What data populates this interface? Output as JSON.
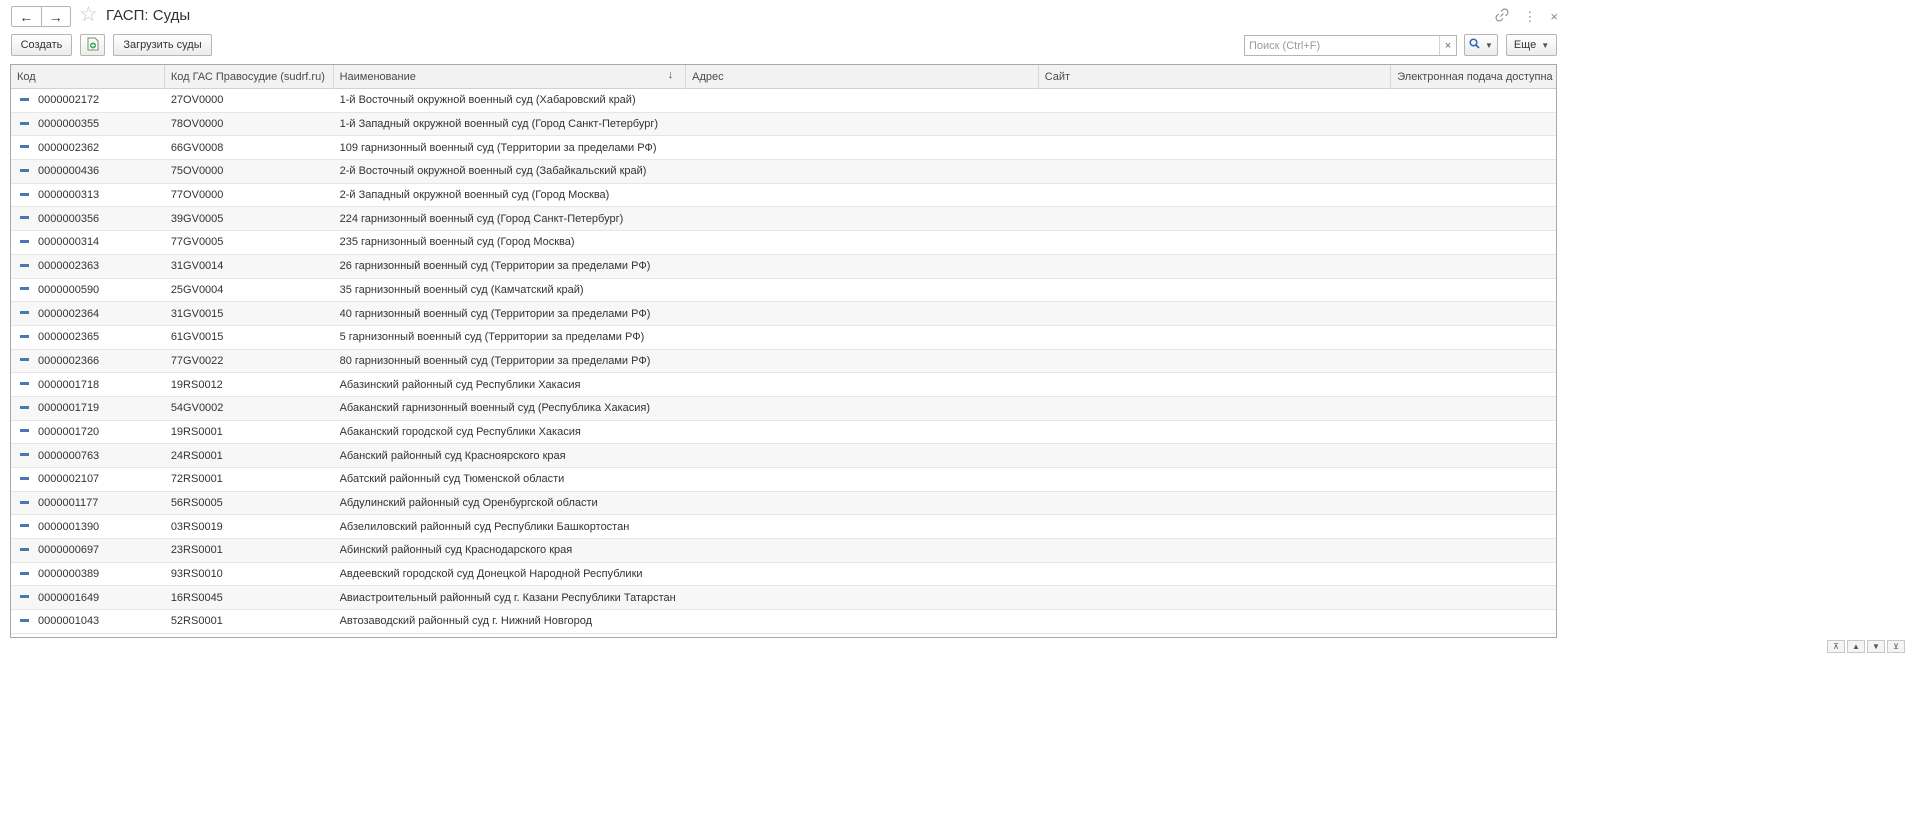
{
  "window": {
    "title": "ГАСП: Суды",
    "back_icon": "arrow-left-icon",
    "forward_icon": "arrow-right-icon",
    "favorite_icon": "star-icon",
    "link_icon": "link-icon",
    "menu_icon": "more-vertical-icon",
    "close_icon": "close-icon"
  },
  "toolbar": {
    "create_label": "Создать",
    "doc_icon": "document-add-icon",
    "load_label": "Загрузить суды",
    "search_placeholder": "Поиск (Ctrl+F)",
    "search_clear": "×",
    "more_label": "Еще"
  },
  "table": {
    "columns": [
      "Код",
      "Код ГАС Правосудие (sudrf.ru)",
      "Наименование",
      "Адрес",
      "Сайт",
      "Электронная подача доступна"
    ],
    "sorted_column": "Наименование",
    "rows": [
      {
        "code": "0000002172",
        "gas": "27OV0000",
        "name": "1-й Восточный окружной военный суд (Хабаровский край)"
      },
      {
        "code": "0000000355",
        "gas": "78OV0000",
        "name": "1-й Западный окружной военный суд (Город Санкт-Петербург)"
      },
      {
        "code": "0000002362",
        "gas": "66GV0008",
        "name": "109 гарнизонный военный суд (Территории за пределами РФ)"
      },
      {
        "code": "0000000436",
        "gas": "75OV0000",
        "name": "2-й Восточный окружной военный суд (Забайкальский край)"
      },
      {
        "code": "0000000313",
        "gas": "77OV0000",
        "name": "2-й Западный окружной военный суд (Город Москва)"
      },
      {
        "code": "0000000356",
        "gas": "39GV0005",
        "name": "224 гарнизонный военный суд (Город Санкт-Петербург)"
      },
      {
        "code": "0000000314",
        "gas": "77GV0005",
        "name": "235 гарнизонный военный суд (Город Москва)"
      },
      {
        "code": "0000002363",
        "gas": "31GV0014",
        "name": "26 гарнизонный военный суд (Территории за пределами РФ)"
      },
      {
        "code": "0000000590",
        "gas": "25GV0004",
        "name": "35 гарнизонный военный суд (Камчатский край)"
      },
      {
        "code": "0000002364",
        "gas": "31GV0015",
        "name": "40 гарнизонный военный суд (Территории за пределами РФ)"
      },
      {
        "code": "0000002365",
        "gas": "61GV0015",
        "name": "5 гарнизонный военный суд (Территории за пределами РФ)"
      },
      {
        "code": "0000002366",
        "gas": "77GV0022",
        "name": "80 гарнизонный военный суд (Территории за пределами РФ)"
      },
      {
        "code": "0000001718",
        "gas": "19RS0012",
        "name": "Абазинский районный суд Республики Хакасия"
      },
      {
        "code": "0000001719",
        "gas": "54GV0002",
        "name": "Абаканский гарнизонный военный суд (Республика Хакасия)"
      },
      {
        "code": "0000001720",
        "gas": "19RS0001",
        "name": "Абаканский городской суд Республики Хакасия"
      },
      {
        "code": "0000000763",
        "gas": "24RS0001",
        "name": "Абанский районный суд Красноярского края"
      },
      {
        "code": "0000002107",
        "gas": "72RS0001",
        "name": "Абатский районный суд Тюменской области"
      },
      {
        "code": "0000001177",
        "gas": "56RS0005",
        "name": "Абдулинский районный суд Оренбургской области"
      },
      {
        "code": "0000001390",
        "gas": "03RS0019",
        "name": "Абзелиловский районный суд Республики Башкортостан"
      },
      {
        "code": "0000000697",
        "gas": "23RS0001",
        "name": "Абинский районный суд Краснодарского края"
      },
      {
        "code": "0000000389",
        "gas": "93RS0010",
        "name": "Авдеевский городской суд Донецкой Народной Республики"
      },
      {
        "code": "0000001649",
        "gas": "16RS0045",
        "name": "Авиастроительный районный суд г. Казани Республики Татарстан"
      },
      {
        "code": "0000001043",
        "gas": "52RS0001",
        "name": "Автозаводский районный суд г. Нижний Новгород"
      }
    ]
  },
  "scroll_controls": [
    "scroll-to-top-icon",
    "scroll-up-icon",
    "scroll-down-icon",
    "scroll-to-bottom-icon"
  ]
}
